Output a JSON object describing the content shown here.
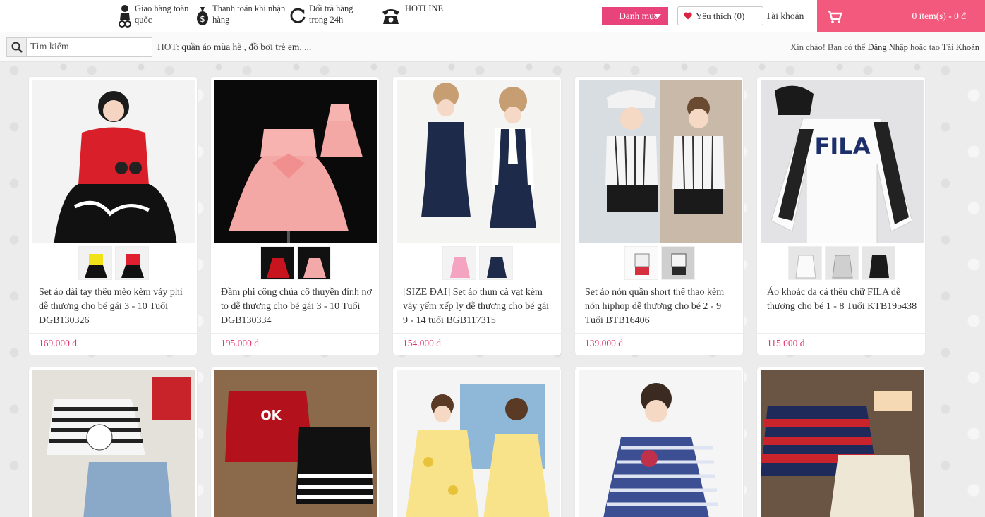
{
  "header": {
    "features": [
      {
        "icon": "delivery-scooter-icon",
        "text": "Giao hàng toàn quốc"
      },
      {
        "icon": "money-bag-icon",
        "text": "Thanh toán khi nhận hàng"
      },
      {
        "icon": "refresh-icon",
        "text": "Đổi trả hàng trong 24h"
      },
      {
        "icon": "phone-icon",
        "text": "HOTLINE"
      }
    ],
    "menu_label": "Danh mục",
    "wishlist_label": "Yêu thích (0)",
    "account_label": "Tài khoản",
    "cart_label": "0 item(s) - 0 đ"
  },
  "search": {
    "placeholder": "Tìm kiếm",
    "hot_label": "HOT:",
    "hot_links": [
      "quần áo mùa hè",
      "đồ bơi trẻ em"
    ],
    "hot_more": ", ...",
    "greeting_prefix": "Xin chào! Bạn có thể",
    "login_link": "Đăng Nhập",
    "greeting_mid": "hoặc tạo",
    "register_link": "Tài Khoản"
  },
  "products": [
    {
      "title": "Set áo dài tay thêu mèo kèm váy phi dễ thương cho bé gái 3 - 10 Tuổi DGB130326",
      "price": "169.000 đ",
      "thumbs": [
        "#f2e21a",
        "#e02030"
      ]
    },
    {
      "title": "Đầm phi công chúa cổ thuyền đính nơ to dễ thương cho bé gái 3 - 10 Tuổi DGB130334",
      "price": "195.000 đ",
      "thumbs": [
        "#c8141e",
        "#f2a9a7"
      ]
    },
    {
      "title": "[SIZE ĐẠI] Set áo thun cà vạt kèm váy yếm xếp ly dễ thương cho bé gái 9 - 14 tuổi BGB117315",
      "price": "154.000 đ",
      "thumbs": [
        "#f4a3c0",
        "#1e2a4a"
      ]
    },
    {
      "title": "Set áo nón quần short thể thao kèm nón hiphop dễ thương cho bé 2 - 9 Tuổi BTB16406",
      "price": "139.000 đ",
      "thumbs": [
        "#d63040",
        "#2a2a2a"
      ]
    },
    {
      "title": "Áo khoác da cá thêu chữ FILA dễ thương cho bé 1 - 8 Tuổi KTB195438",
      "price": "115.000 đ",
      "thumbs": [
        "#e8e8e8",
        "#cfcfcf",
        "#1a1a1a"
      ]
    },
    {
      "title": "",
      "price": "",
      "thumbs": []
    },
    {
      "title": "",
      "price": "",
      "thumbs": []
    },
    {
      "title": "",
      "price": "",
      "thumbs": []
    },
    {
      "title": "",
      "price": "",
      "thumbs": []
    },
    {
      "title": "",
      "price": "",
      "thumbs": []
    }
  ],
  "colors": {
    "accent_pink": "#e8437a",
    "cart_pink": "#f3597d",
    "price_red": "#e0356b"
  }
}
